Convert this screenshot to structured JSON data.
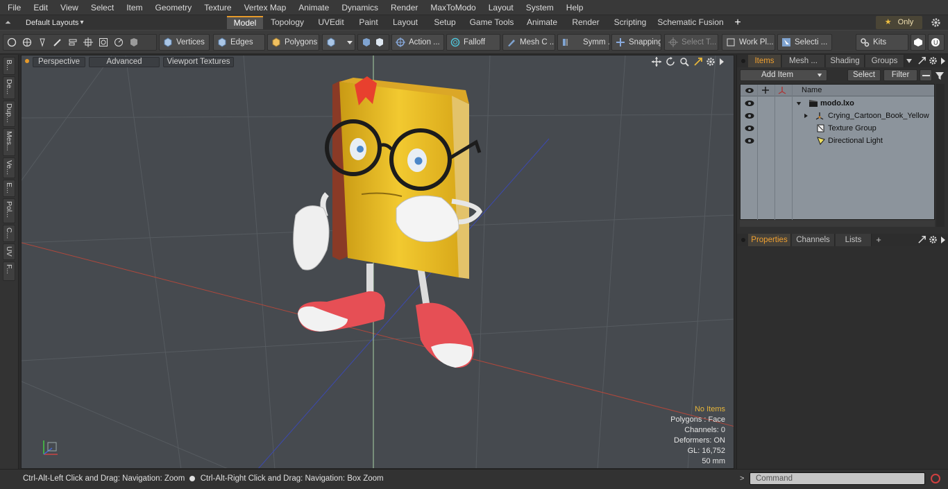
{
  "menu": [
    "File",
    "Edit",
    "View",
    "Select",
    "Item",
    "Geometry",
    "Texture",
    "Vertex Map",
    "Animate",
    "Dynamics",
    "Render",
    "MaxToModo",
    "Layout",
    "System",
    "Help"
  ],
  "layouts": {
    "label": "Default Layouts",
    "caret": "▾"
  },
  "tabs": [
    {
      "label": "Model",
      "active": true
    },
    {
      "label": "Topology"
    },
    {
      "label": "UVEdit"
    },
    {
      "label": "Paint"
    },
    {
      "label": "Layout"
    },
    {
      "label": "Setup"
    },
    {
      "label": "Game Tools"
    },
    {
      "label": "Animate"
    },
    {
      "label": "Render"
    },
    {
      "label": "Scripting"
    },
    {
      "label": "Schematic Fusion"
    }
  ],
  "tab_add": "+",
  "only_label": "Only",
  "toolbar": {
    "vertices": "Vertices",
    "edges": "Edges",
    "polygons": "Polygons",
    "action": "Action ...",
    "falloff": "Falloff",
    "mesh": "Mesh C ...",
    "symm": "Symm ...",
    "snapping": "Snapping",
    "select_t": "Select T...",
    "work_pl": "Work Pl...",
    "selecti": "Selecti ...",
    "kits": "Kits"
  },
  "left_tabs": [
    "B...",
    "De...",
    "Dup...",
    "Mes...",
    "Ve...",
    "E...",
    "Pol...",
    "C...",
    "UV",
    "F..."
  ],
  "viewport": {
    "perspective": "Perspective",
    "advanced": "Advanced",
    "textures": "Viewport Textures",
    "info": {
      "no_items": "No Items",
      "polygons": "Polygons : Face",
      "channels": "Channels: 0",
      "deformers": "Deformers: ON",
      "gl": "GL: 16,752",
      "size": "50 mm"
    }
  },
  "items_panel": {
    "tabs": [
      "Items",
      "Mesh ...",
      "Shading",
      "Groups"
    ],
    "add_item": "Add Item",
    "select": "Select",
    "filter": "Filter",
    "col_name": "Name",
    "rows": [
      {
        "label": "modo.lxo",
        "bold": true
      },
      {
        "label": "Crying_Cartoon_Book_Yellow"
      },
      {
        "label": "Texture Group"
      },
      {
        "label": "Directional Light"
      }
    ]
  },
  "props_panel": {
    "tabs": [
      "Properties",
      "Channels",
      "Lists"
    ],
    "add": "+"
  },
  "status": {
    "left": "Ctrl-Alt-Left Click and Drag: Navigation: Zoom",
    "right": "Ctrl-Alt-Right Click and Drag: Navigation: Box Zoom",
    "command_placeholder": "Command",
    "prompt": ">"
  }
}
